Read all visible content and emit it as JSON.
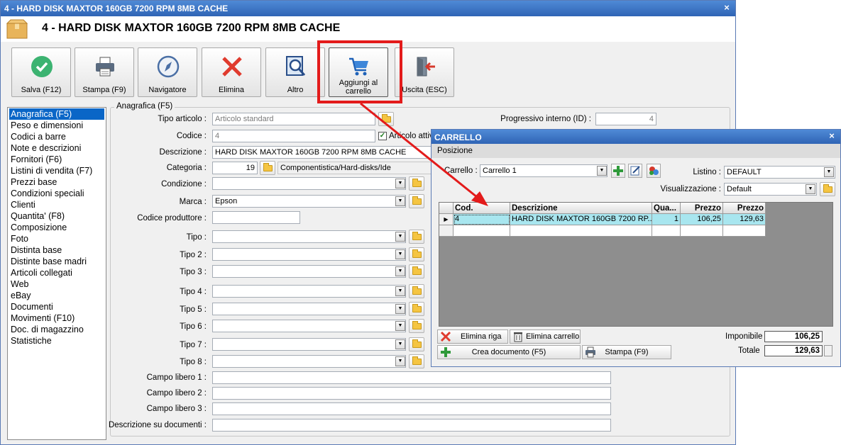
{
  "window": {
    "title": "4 - HARD DISK MAXTOR 160GB 7200 RPM 8MB CACHE",
    "close": "×"
  },
  "header": {
    "title": "4 - HARD DISK MAXTOR 160GB 7200 RPM 8MB CACHE"
  },
  "toolbar": {
    "save": "Salva (F12)",
    "print": "Stampa (F9)",
    "navigator": "Navigatore",
    "delete": "Elimina",
    "other": "Altro",
    "add_cart_1": "Aggiungi al",
    "add_cart_2": "carrello",
    "exit": "Uscita (ESC)"
  },
  "nav": [
    "Anagrafica (F5)",
    "Peso e dimensioni",
    "Codici a barre",
    "Note e descrizioni",
    "Fornitori (F6)",
    "Listini di vendita (F7)",
    "Prezzi base",
    "Condizioni speciali",
    "Clienti",
    "Quantita' (F8)",
    "Composizione",
    "Foto",
    "Distinta base",
    "Distinte base madri",
    "Articoli collegati",
    "Web",
    "eBay",
    "Documenti",
    "Movimenti (F10)",
    "Doc. di magazzino",
    "Statistiche"
  ],
  "form": {
    "group_title": "Anagrafica (F5)",
    "tipo_articolo_label": "Tipo articolo :",
    "tipo_articolo_value": "Articolo standard",
    "progressivo_label": "Progressivo interno (ID) :",
    "progressivo_value": "4",
    "codice_label": "Codice :",
    "codice_value": "4",
    "articolo_attivo_label": "Articolo attivo",
    "descrizione_label": "Descrizione :",
    "descrizione_value": "HARD DISK MAXTOR 160GB 7200 RPM 8MB CACHE",
    "categoria_label": "Categoria :",
    "categoria_id": "19",
    "categoria_value": "Componentistica/Hard-disks/Ide",
    "condizione_label": "Condizione :",
    "marca_label": "Marca :",
    "marca_value": "Epson",
    "codice_produttore_label": "Codice produttore :",
    "tipo_labels": [
      "Tipo :",
      "Tipo 2 :",
      "Tipo 3 :",
      "Tipo 4 :",
      "Tipo 5 :",
      "Tipo 6 :",
      "Tipo 7 :",
      "Tipo 8 :"
    ],
    "campo_labels": [
      "Campo libero 1 :",
      "Campo libero 2 :",
      "Campo libero 3 :"
    ],
    "descrizione_documenti_label": "Descrizione su documenti :"
  },
  "cart": {
    "title": "CARRELLO",
    "menu": "Posizione",
    "carrello_label": "Carrello :",
    "carrello_value": "Carrello 1",
    "listino_label": "Listino :",
    "listino_value": "DEFAULT",
    "visualizzazione_label": "Visualizzazione :",
    "visualizzazione_value": "Default",
    "columns": [
      "Cod.",
      "Descrizione",
      "Qua...",
      "Prezzo",
      "Prezzo"
    ],
    "rows": [
      {
        "cod": "4",
        "descrizione": "HARD DISK MAXTOR 160GB 7200 RP...",
        "qta": "1",
        "prezzo": "106,25",
        "prezzo2": "129,63"
      }
    ],
    "elimina_riga": "Elimina riga",
    "elimina_carrello": "Elimina carrello",
    "crea_documento": "Crea documento (F5)",
    "stampa": "Stampa (F9)",
    "imponibile_label": "Imponibile",
    "imponibile_value": "106,25",
    "totale_label": "Totale",
    "totale_value": "129,63"
  },
  "colors": {
    "highlight": "#e31b1b",
    "selection": "#0a66c7",
    "row": "#a8e6ef",
    "titlebar": "#2f64b5"
  }
}
